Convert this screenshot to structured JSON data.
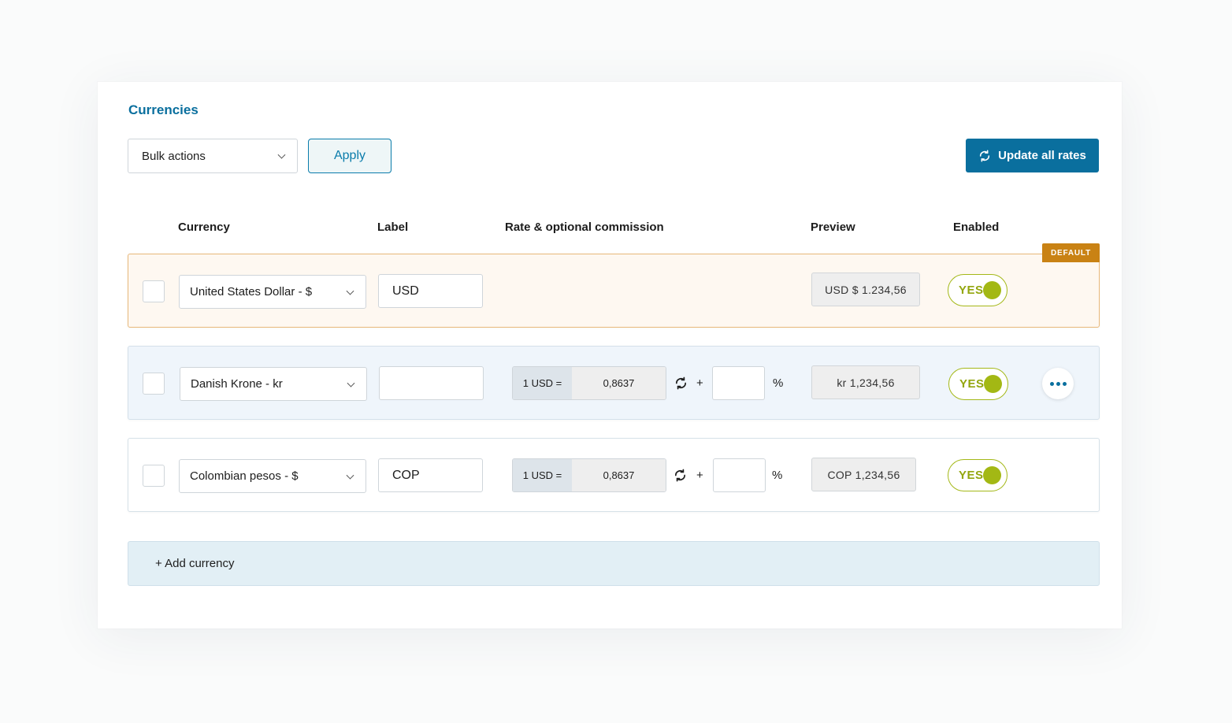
{
  "section": {
    "title": "Currencies"
  },
  "toolbar": {
    "bulk_actions": "Bulk actions",
    "apply": "Apply",
    "update_all_rates": "Update all rates"
  },
  "headers": {
    "currency": "Currency",
    "label": "Label",
    "rate": "Rate & optional commission",
    "preview": "Preview",
    "enabled": "Enabled"
  },
  "default_badge": "DEFAULT",
  "rows": [
    {
      "currency": "United States Dollar - $",
      "label": "USD",
      "preview": "USD $ 1.234,56",
      "enabled": "YES"
    },
    {
      "currency": "Danish Krone - kr",
      "label": "",
      "rate_prefix": "1 USD =",
      "rate": "0,8637",
      "plus": "+",
      "percent": "%",
      "commission": "",
      "preview": "kr 1,234,56",
      "enabled": "YES"
    },
    {
      "currency": "Colombian pesos - $",
      "label": "COP",
      "rate_prefix": "1 USD =",
      "rate": "0,8637",
      "plus": "+",
      "percent": "%",
      "commission": "",
      "preview": "COP 1,234,56",
      "enabled": "YES"
    }
  ],
  "add_currency": "+ Add currency",
  "colors": {
    "primary": "#0a6f9e",
    "default_badge": "#c98214",
    "toggle_on": "#a3b814",
    "default_row_bg": "#fef8f1",
    "hover_row_bg": "#eff5fb"
  },
  "icons": [
    "refresh-icon",
    "chevron-down-icon",
    "more-horizontal-icon"
  ]
}
